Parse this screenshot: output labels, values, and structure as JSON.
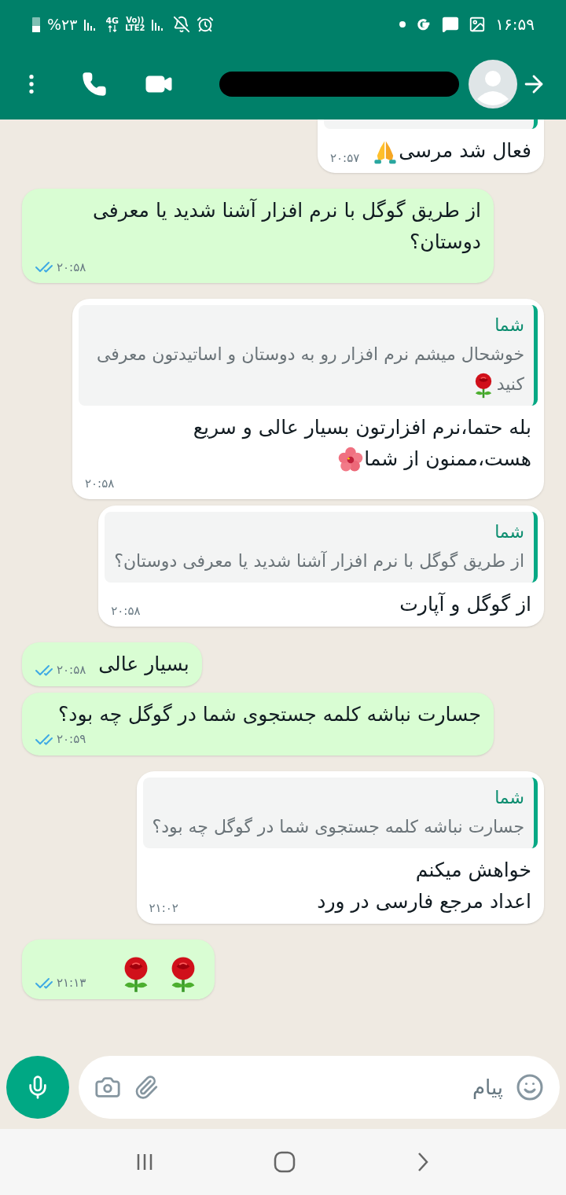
{
  "status_bar": {
    "battery": "%۲۳",
    "network": "4G",
    "volte": "Vo))",
    "lte": "LTE2",
    "time": "۱۶:۵۹"
  },
  "messages": [
    {
      "kind": "received",
      "quote_cut": true,
      "text": "فعال شد مرسی",
      "emojis": [
        {
          "kind": "praying-hands"
        }
      ],
      "time": "۲۰:۵۷"
    },
    {
      "kind": "sent",
      "read": true,
      "text": "از طریق گوگل با نرم افزار آشنا شدید یا معرفی دوستان؟",
      "time": "۲۰:۵۸"
    },
    {
      "kind": "received",
      "quote": {
        "author": "شما",
        "text": "خوشحال میشم نرم افزار رو به دوستان و اساتیدتون معرفی کنید",
        "emojis": [
          {
            "kind": "rose"
          }
        ]
      },
      "text": "بله حتما،نرم افزارتون بسیار عالی و سریع هست،ممنون از شما",
      "emojis": [
        {
          "kind": "hibiscus"
        }
      ],
      "time": "۲۰:۵۸"
    },
    {
      "kind": "received",
      "quote": {
        "author": "شما",
        "text": "از طریق گوگل با نرم افزار آشنا شدید یا معرفی دوستان؟"
      },
      "text": "از گوگل و آپارت",
      "time": "۲۰:۵۸"
    },
    {
      "kind": "sent",
      "read": true,
      "text": "بسیار عالی",
      "time": "۲۰:۵۸"
    },
    {
      "kind": "sent",
      "read": true,
      "text": "جسارت نباشه کلمه جستجوی شما در گوگل چه بود؟",
      "time": "۲۰:۵۹"
    },
    {
      "kind": "received",
      "quote": {
        "author": "شما",
        "text": "جسارت نباشه کلمه جستجوی شما در گوگل چه بود؟"
      },
      "text": "خواهش میکنم\nاعداد مرجع فارسی در ورد",
      "time": "۲۱:۰۲"
    },
    {
      "kind": "sent",
      "read": true,
      "emojis": [
        {
          "kind": "rose"
        },
        {
          "kind": "rose"
        }
      ],
      "time": "۲۱:۱۳"
    }
  ],
  "composer": {
    "placeholder": "پیام"
  }
}
